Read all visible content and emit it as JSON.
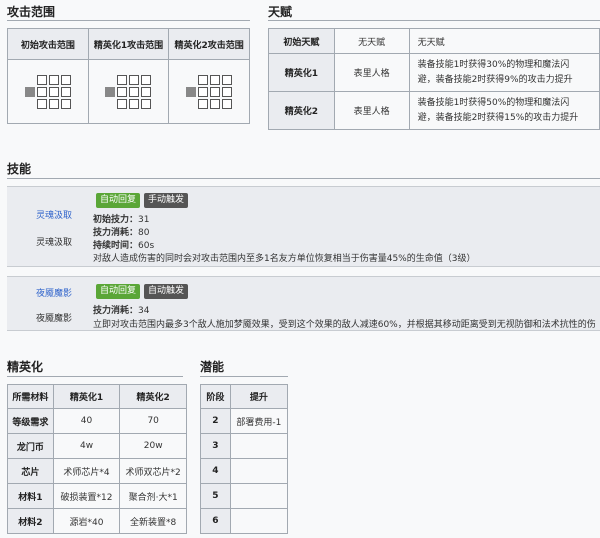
{
  "attack_range": {
    "title": "攻击范围",
    "headers": [
      "初始攻击范围",
      "精英化1攻击范围",
      "精英化2攻击范围"
    ]
  },
  "talent": {
    "title": "天赋",
    "rows": [
      {
        "stage": "初始天赋",
        "name": "无天赋",
        "desc": [
          "无天赋"
        ]
      },
      {
        "stage": "精英化1",
        "name": "表里人格",
        "desc": [
          "装备技能1时获得30%的物理和魔法闪",
          "避，装备技能2时获得9%的攻击力提升"
        ]
      },
      {
        "stage": "精英化2",
        "name": "表里人格",
        "desc": [
          "装备技能1时获得50%的物理和魔法闪",
          "避，装备技能2时获得15%的攻击力提升"
        ]
      }
    ]
  },
  "skills": {
    "title": "技能",
    "items": [
      {
        "link": "灵魂汲取",
        "name": "灵魂汲取",
        "badges": [
          "自动回复",
          "手动触发"
        ],
        "stats": [
          {
            "label": "初始技力：",
            "value": "31"
          },
          {
            "label": "技力消耗：",
            "value": "80"
          },
          {
            "label": "持续时间：",
            "value": "60s"
          }
        ],
        "desc": "对敌人造成伤害的同时会对攻击范围内至多1名友方单位恢复相当于伤害量45%的生命值（3级）"
      },
      {
        "link": "夜魇魔影",
        "name": "夜魇魔影",
        "badges": [
          "自动回复",
          "自动触发"
        ],
        "stats": [
          {
            "label": "技力消耗：",
            "value": "34"
          }
        ],
        "desc": "立即对攻击范围内最多3个敌人施加梦魇效果，受到这个效果的敌人减速60%，并根据其移动距离受到无视防御和法术抗性的伤"
      }
    ]
  },
  "elite": {
    "title": "精英化",
    "headers": [
      "所需材料",
      "精英化1",
      "精英化2"
    ],
    "rows": [
      {
        "label": "等级需求",
        "e1": "40",
        "e2": "70"
      },
      {
        "label": "龙门币",
        "e1": "4w",
        "e2": "20w"
      },
      {
        "label": "芯片",
        "e1": "术师芯片*4",
        "e2": "术师双芯片*2"
      },
      {
        "label": "材料1",
        "e1": "破损装置*12",
        "e2": "聚合剂·大*1"
      },
      {
        "label": "材料2",
        "e1": "源岩*40",
        "e2": "全新装置*8"
      }
    ]
  },
  "potential": {
    "title": "潜能",
    "headers": [
      "阶段",
      "提升"
    ],
    "rows": [
      {
        "stage": "2",
        "bonus": "部署费用-1"
      },
      {
        "stage": "3",
        "bonus": ""
      },
      {
        "stage": "4",
        "bonus": ""
      },
      {
        "stage": "5",
        "bonus": ""
      },
      {
        "stage": "6",
        "bonus": ""
      }
    ]
  }
}
